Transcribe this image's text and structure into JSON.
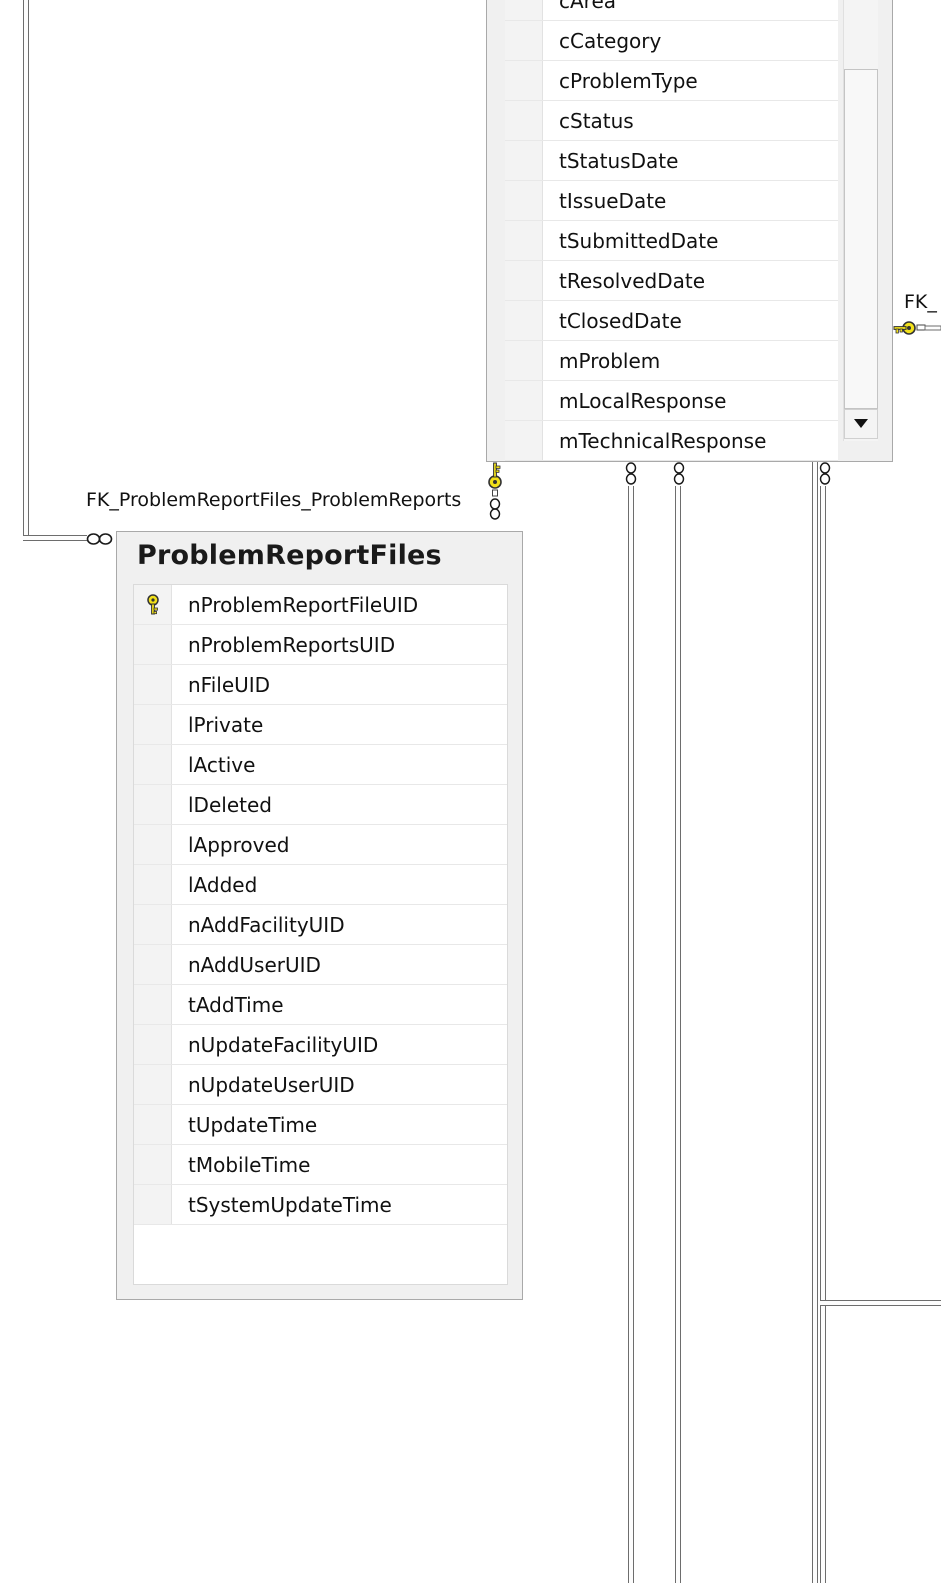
{
  "problem_reports_table": {
    "columns": [
      "cArea",
      "cCategory",
      "cProblemType",
      "cStatus",
      "tStatusDate",
      "tIssueDate",
      "tSubmittedDate",
      "tResolvedDate",
      "tClosedDate",
      "mProblem",
      "mLocalResponse",
      "mTechnicalResponse"
    ]
  },
  "problem_report_files_table": {
    "title": "ProblemReportFiles",
    "primary_key_column": "nProblemReportFileUID",
    "columns": [
      "nProblemReportFileUID",
      "nProblemReportsUID",
      "nFileUID",
      "lPrivate",
      "lActive",
      "lDeleted",
      "lApproved",
      "lAdded",
      "nAddFacilityUID",
      "nAddUserUID",
      "tAddTime",
      "nUpdateFacilityUID",
      "nUpdateUserUID",
      "tUpdateTime",
      "tMobileTime",
      "tSystemUpdateTime"
    ]
  },
  "relationships": {
    "fk_problem_report_files": "FK_ProblemReportFiles_ProblemReports",
    "fk_right_partial": "FK_"
  },
  "icons": {
    "primary_key": "key-icon",
    "scroll_down": "triangle-down-icon",
    "many_end": "infinity-icon"
  },
  "colors": {
    "key_yellow": "#f2e11a",
    "line_gray": "#6d6d6d"
  }
}
